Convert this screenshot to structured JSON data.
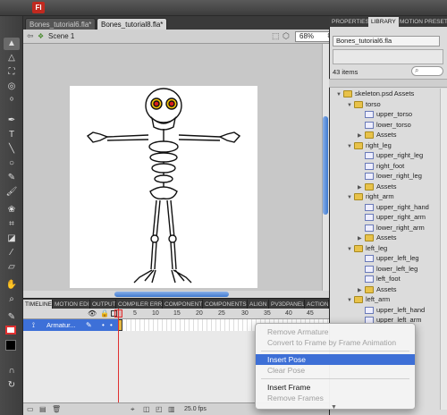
{
  "document_tabs": [
    "Bones_tutorial6.fla*",
    "Bones_tutorial8.fla*"
  ],
  "scene": {
    "label": "Scene 1",
    "zoom": "68%"
  },
  "panel_tabs": [
    "TIMELINE",
    "MOTION EDIT",
    "OUTPUT",
    "COMPILER ERR",
    "COMPONENT",
    "COMPONENTS",
    "ALIGN",
    "PV3DPANEL",
    "ACTIONS"
  ],
  "timeline": {
    "frame_numbers": [
      "5",
      "10",
      "15",
      "20",
      "25",
      "30",
      "35",
      "40",
      "45"
    ],
    "layer_name": "Armatur...",
    "fps": "25.0 fps"
  },
  "right_panel": {
    "tabs": [
      "PROPERTIES",
      "LIBRARY",
      "MOTION PRESETS"
    ],
    "library_file": "Bones_tutorial6.fla",
    "item_count": "43 items",
    "tree": [
      {
        "label": "skeleton.psd Assets",
        "type": "folder",
        "level": 0,
        "expanded": true
      },
      {
        "label": "torso",
        "type": "folder",
        "level": 1,
        "expanded": true
      },
      {
        "label": "upper_torso",
        "type": "graphic",
        "level": 2
      },
      {
        "label": "lower_torso",
        "type": "graphic",
        "level": 2
      },
      {
        "label": "Assets",
        "type": "folder",
        "level": 2,
        "expanded": false
      },
      {
        "label": "right_leg",
        "type": "folder",
        "level": 1,
        "expanded": true
      },
      {
        "label": "upper_right_leg",
        "type": "graphic",
        "level": 2
      },
      {
        "label": "right_foot",
        "type": "graphic",
        "level": 2
      },
      {
        "label": "lower_right_leg",
        "type": "graphic",
        "level": 2
      },
      {
        "label": "Assets",
        "type": "folder",
        "level": 2,
        "expanded": false
      },
      {
        "label": "right_arm",
        "type": "folder",
        "level": 1,
        "expanded": true
      },
      {
        "label": "upper_right_hand",
        "type": "graphic",
        "level": 2
      },
      {
        "label": "upper_right_arm",
        "type": "graphic",
        "level": 2
      },
      {
        "label": "lower_right_arm",
        "type": "graphic",
        "level": 2
      },
      {
        "label": "Assets",
        "type": "folder",
        "level": 2,
        "expanded": false
      },
      {
        "label": "left_leg",
        "type": "folder",
        "level": 1,
        "expanded": true
      },
      {
        "label": "upper_left_leg",
        "type": "graphic",
        "level": 2
      },
      {
        "label": "lower_left_leg",
        "type": "graphic",
        "level": 2
      },
      {
        "label": "left_foot",
        "type": "graphic",
        "level": 2
      },
      {
        "label": "Assets",
        "type": "folder",
        "level": 2,
        "expanded": false
      },
      {
        "label": "left_arm",
        "type": "folder",
        "level": 1,
        "expanded": true
      },
      {
        "label": "upper_left_hand",
        "type": "graphic",
        "level": 2
      },
      {
        "label": "upper_left_arm",
        "type": "graphic",
        "level": 2
      }
    ]
  },
  "context_menu": {
    "items": [
      {
        "label": "Remove Armature",
        "enabled": false
      },
      {
        "label": "Convert to Frame by Frame Animation",
        "enabled": false
      },
      {
        "separator": true
      },
      {
        "label": "Insert Pose",
        "enabled": true,
        "selected": true
      },
      {
        "label": "Clear Pose",
        "enabled": false
      },
      {
        "separator": true
      },
      {
        "label": "Insert Frame",
        "enabled": true
      },
      {
        "label": "Remove Frames",
        "enabled": false
      }
    ],
    "more_indicator": "▼"
  },
  "colors": {
    "selection": "#3d6fd6",
    "app_red": "#c0291f",
    "scroll_blue": "#3e7ad0"
  },
  "app_badge": "Fl"
}
